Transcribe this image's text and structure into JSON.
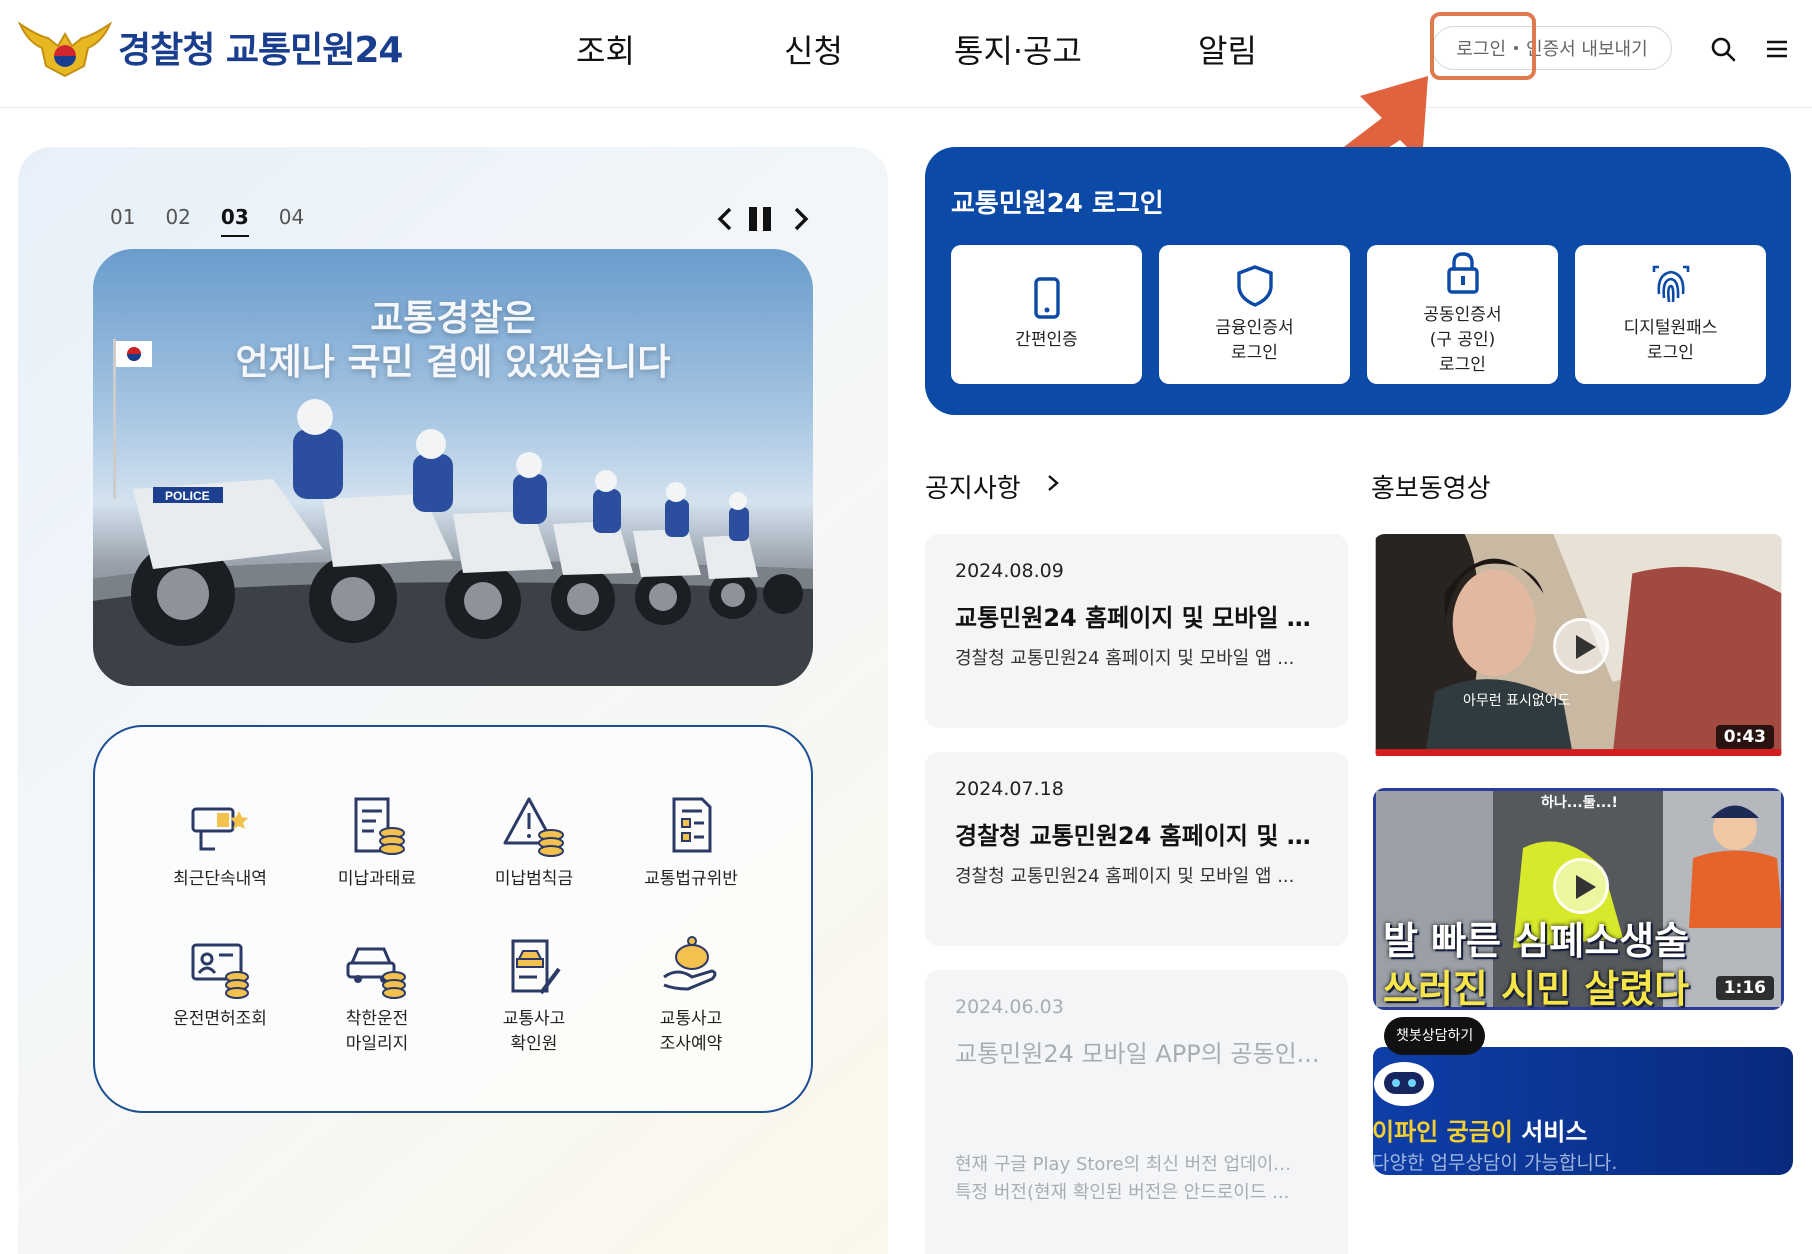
{
  "header": {
    "logo_text": "경찰청 교통민원24",
    "nav": [
      "조회",
      "신청",
      "통지·공고",
      "알림"
    ],
    "login_label": "로그인",
    "cert_export_label": "인증서 내보내기"
  },
  "colors": {
    "brand_blue": "#0b4aa6",
    "highlight_orange": "#e07a4e",
    "chat_accent": "#f3d02e"
  },
  "slider": {
    "tabs": [
      "01",
      "02",
      "03",
      "04"
    ],
    "active_tab": "03",
    "banner_line1": "교통경찰은",
    "banner_line2": "언제나 국민 곁에 있겠습니다"
  },
  "quick_menu": [
    {
      "label": "최근단속내역",
      "icon": "camera-icon"
    },
    {
      "label": "미납과태료",
      "icon": "receipt-coins-icon"
    },
    {
      "label": "미납범칙금",
      "icon": "warning-coins-icon"
    },
    {
      "label": "교통법규위반",
      "icon": "document-list-icon"
    },
    {
      "label": "운전면허조회",
      "icon": "id-card-icon"
    },
    {
      "label": "착한운전\n마일리지",
      "icon": "car-coins-icon"
    },
    {
      "label": "교통사고\n확인원",
      "icon": "accident-doc-icon"
    },
    {
      "label": "교통사고\n조사예약",
      "icon": "piggy-hand-icon"
    }
  ],
  "login_card": {
    "title": "교통민원24 로그인",
    "buttons": [
      {
        "label": "간편인증",
        "icon": "phone-icon"
      },
      {
        "label": "금융인증서\n로그인",
        "icon": "shield-icon"
      },
      {
        "label": "공동인증서\n(구 공인)\n로그인",
        "icon": "lock-icon"
      },
      {
        "label": "디지털원패스\n로그인",
        "icon": "fingerprint-icon"
      }
    ]
  },
  "notice": {
    "title": "공지사항",
    "items": [
      {
        "date": "2024.08.09",
        "title": "교통민원24 홈페이지 및 모바일 앱...",
        "desc": "경찰청 교통민원24 홈페이지 및 모바일 앱 ..."
      },
      {
        "date": "2024.07.18",
        "title": "경찰청 교통민원24 홈페이지 및 모...",
        "desc": "경찰청 교통민원24 홈페이지 및 모바일 앱 ..."
      },
      {
        "date": "2024.06.03",
        "title": "교통민원24 모바일 APP의 공동인...",
        "desc": "현재 구글 Play Store의 최신 버전 업데이트...",
        "desc2": "특정 버전(현재 확인된 버전은 안드로이드 ..."
      }
    ]
  },
  "video": {
    "title": "홍보동영상",
    "items": [
      {
        "duration": "0:43",
        "caption": "아무런 표시없어도"
      },
      {
        "duration": "1:16",
        "top_caption": "하나...둘...!",
        "caption_line1": "발 빠른 심폐소생술",
        "caption_line2": "쓰러진 시민 살렸다"
      }
    ]
  },
  "chatbot": {
    "bubble": "챗봇상담하기",
    "title_highlight": "이파인 궁금이",
    "title_rest": " 서비스",
    "subtitle": "다양한 업무상담이 가능합니다."
  }
}
